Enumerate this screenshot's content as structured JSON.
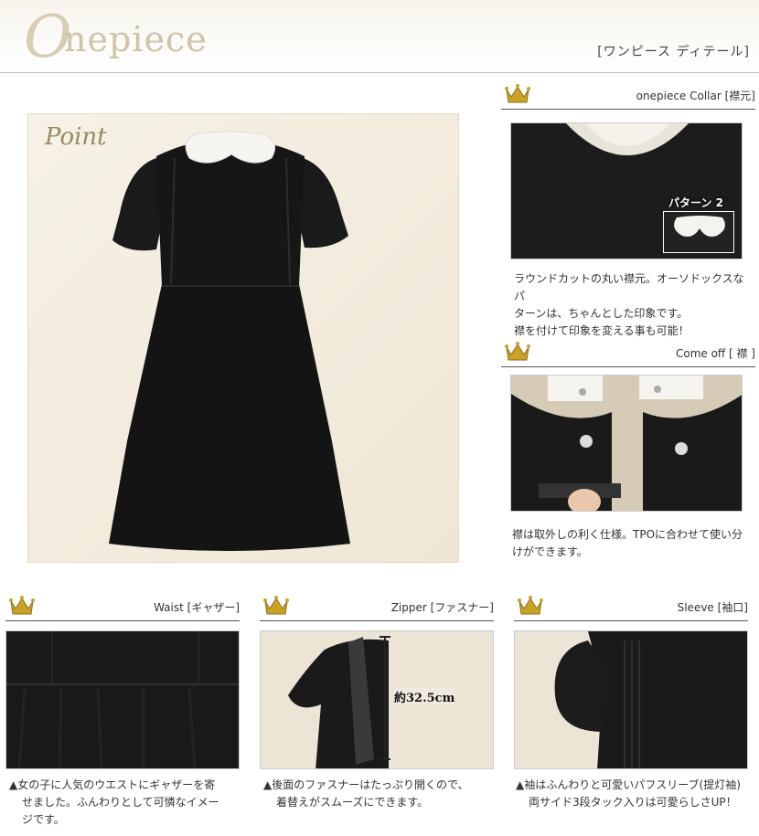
{
  "header": {
    "logo_initial": "O",
    "logo_rest": "nepiece",
    "subtitle": "[ワンピース ディテール]"
  },
  "main": {
    "point_label": "Point"
  },
  "sections": {
    "collar": {
      "title": "onepiece Collar [襟元]",
      "badge": "パターン 2",
      "desc_lines": [
        "ラウンドカットの丸い襟元。オーソドックスなパ",
        "ターンは、ちゃんとした印象です。",
        "襟を付けて印象を変える事も可能！"
      ]
    },
    "comeoff": {
      "title": "Come off [ 襟 ]",
      "desc_lines": [
        "襟は取外しの利く仕様。TPOに合わせて使い分",
        "けができます。"
      ]
    },
    "waist": {
      "title": "Waist [ギャザー]",
      "desc_lines": [
        "▲女の子に人気のウエストにギャザーを寄",
        "せました。ふんわりとして可憐なイメー",
        "ジです。"
      ]
    },
    "zipper": {
      "title": "Zipper [ファスナー]",
      "measure": "約32.5cm",
      "desc_lines": [
        "▲後面のファスナーはたっぷり開くので、",
        "着替えがスムーズにできます。"
      ]
    },
    "sleeve": {
      "title": "Sleeve [袖口]",
      "desc_lines": [
        "▲袖はふんわりと可愛いパフスリーブ(提灯袖)",
        "両サイド3段タック入りは可愛らしさUP！"
      ]
    }
  },
  "colors": {
    "gold": "#c9a227",
    "dress": "#151515",
    "cream": "#f3eee2"
  }
}
